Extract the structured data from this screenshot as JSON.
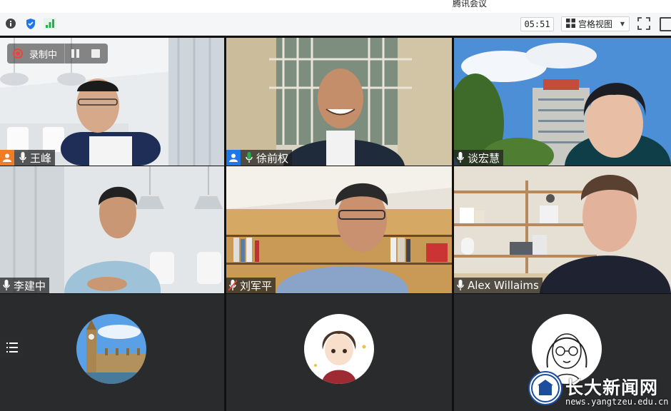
{
  "window": {
    "title": "腾讯会议"
  },
  "toolbar": {
    "info_icon": "info-icon",
    "shield_icon": "shield-icon",
    "signal_icon": "signal-icon",
    "timer": "05:51",
    "view_label": "宫格视图",
    "view_icon": "grid-icon",
    "fullscreen_icon": "fullscreen-icon"
  },
  "recording": {
    "label": "录制中"
  },
  "participants": [
    {
      "name": "王峰",
      "host": true,
      "host_color": "#f07d23",
      "mic": "on"
    },
    {
      "name": "徐前权",
      "host": true,
      "host_color": "#1e77e8",
      "mic": "speaking"
    },
    {
      "name": "谈宏慧",
      "host": false,
      "mic": "on"
    },
    {
      "name": "李建中",
      "host": false,
      "mic": "on"
    },
    {
      "name": "刘军平",
      "host": false,
      "mic": "muted"
    },
    {
      "name": "Alex Willaims",
      "host": false,
      "mic": "on"
    }
  ],
  "watermark": {
    "brand": "长大新闻网",
    "url": "news.yangtzeu.edu.cn"
  },
  "colors": {
    "accent_green": "#22b14c",
    "recording_red": "#e8453c",
    "grid_bg": "#1f2021"
  }
}
